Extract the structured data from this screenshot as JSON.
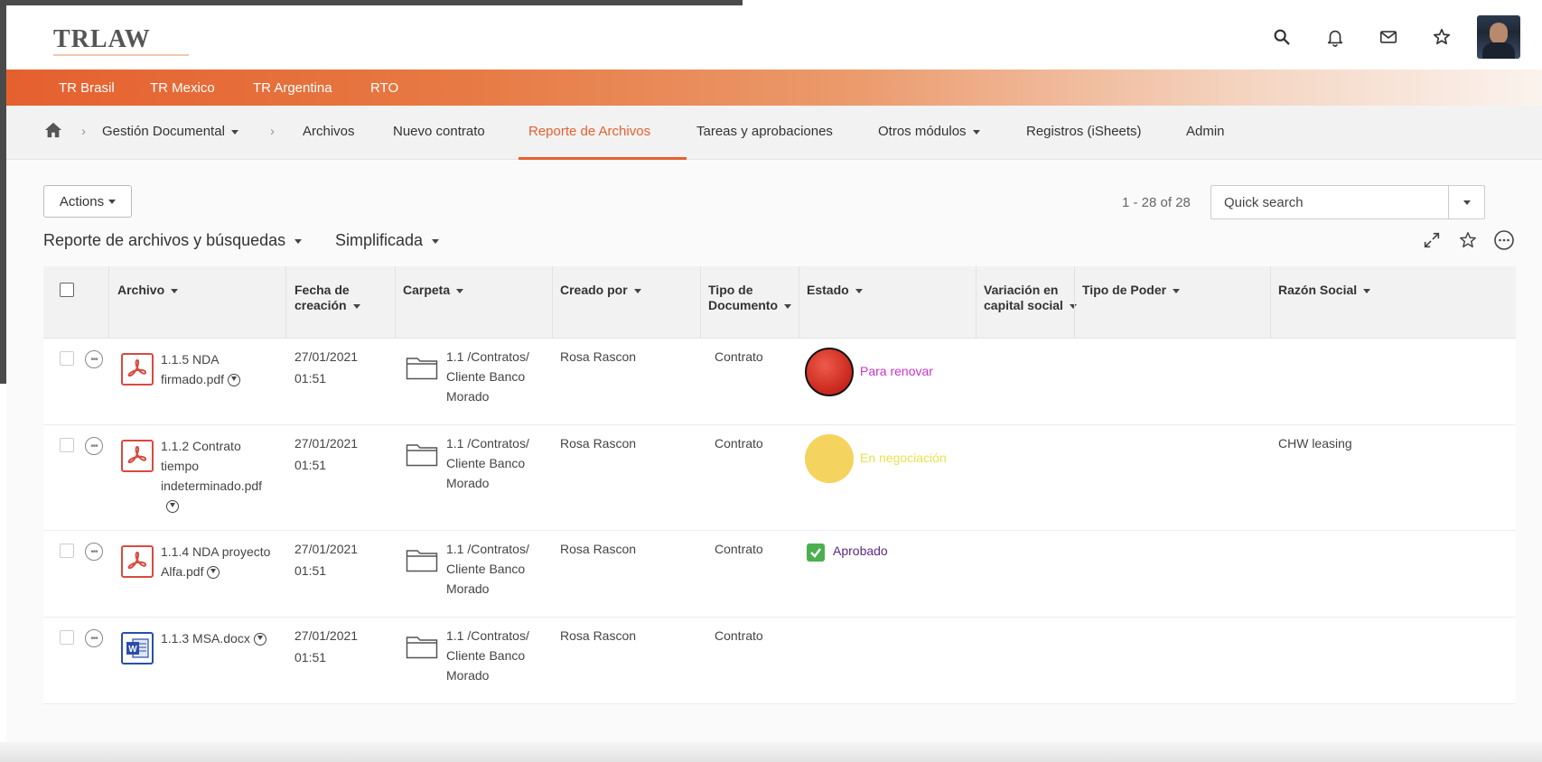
{
  "brand": {
    "logo": "TRLAW"
  },
  "header_icons": [
    "search-icon",
    "bell-icon",
    "mail-icon",
    "star-icon"
  ],
  "orange_nav": [
    "TR Brasil",
    "TR Mexico",
    "TR Argentina",
    "RTO"
  ],
  "nav": {
    "gestion": "Gestión Documental",
    "archivos": "Archivos",
    "nuevo": "Nuevo contrato",
    "reporte": "Reporte de Archivos",
    "tareas": "Tareas y aprobaciones",
    "otros": "Otros módulos",
    "registros": "Registros (iSheets)",
    "admin": "Admin"
  },
  "toolbar": {
    "actions_label": "Actions",
    "count": "1 - 28 of 28",
    "search_placeholder": "Quick search",
    "report_title": "Reporte de archivos y búsquedas",
    "report_view": "Simplificada"
  },
  "columns": {
    "archivo": "Archivo",
    "fecha_1": "Fecha de",
    "fecha_2": "creación",
    "carpeta": "Carpeta",
    "creado": "Creado por",
    "tipo_1": "Tipo de",
    "tipo_2": "Documento",
    "estado": "Estado",
    "variacion_1": "Variación en",
    "variacion_2": "capital social",
    "poder": "Tipo de Poder",
    "razon": "Razón Social"
  },
  "rows": [
    {
      "file_type": "pdf",
      "name_1": "1.1.5  NDA",
      "name_2": "firmado.pdf",
      "name_3": "",
      "date": "27/01/2021",
      "time": "01:51",
      "folder_1": "1.1 /Contratos/",
      "folder_2": "Cliente Banco",
      "folder_3": "Morado",
      "created_by": "Rosa Rascon",
      "doc_type": "Contrato",
      "status": "Para renovar",
      "status_kind": "red",
      "status_color": "#cc33cc",
      "razon": ""
    },
    {
      "file_type": "pdf",
      "name_1": "1.1.2  Contrato",
      "name_2": "tiempo",
      "name_3": "indeterminado.pdf",
      "date": "27/01/2021",
      "time": "01:51",
      "folder_1": "1.1 /Contratos/",
      "folder_2": "Cliente Banco",
      "folder_3": "Morado",
      "created_by": "Rosa Rascon",
      "doc_type": "Contrato",
      "status": "En negociación",
      "status_kind": "yellow",
      "status_color": "#e6e34a",
      "razon": "CHW leasing"
    },
    {
      "file_type": "pdf",
      "name_1": "1.1.4  NDA proyecto",
      "name_2": "Alfa.pdf",
      "name_3": "",
      "date": "27/01/2021",
      "time": "01:51",
      "folder_1": "1.1 /Contratos/",
      "folder_2": "Cliente Banco",
      "folder_3": "Morado",
      "created_by": "Rosa Rascon",
      "doc_type": "Contrato",
      "status": "Aprobado",
      "status_kind": "check",
      "status_color": "#5b2a86",
      "razon": ""
    },
    {
      "file_type": "word",
      "name_1": "1.1.3  MSA.docx",
      "name_2": "",
      "name_3": "",
      "date": "27/01/2021",
      "time": "01:51",
      "folder_1": "1.1 /Contratos/",
      "folder_2": "Cliente Banco",
      "folder_3": "Morado",
      "created_by": "Rosa Rascon",
      "doc_type": "Contrato",
      "status": "",
      "status_kind": "none",
      "status_color": "#333333",
      "razon": ""
    }
  ],
  "colors": {
    "accent": "#e5602f",
    "pdf": "#d84a3f",
    "word": "#2b4fa8"
  }
}
